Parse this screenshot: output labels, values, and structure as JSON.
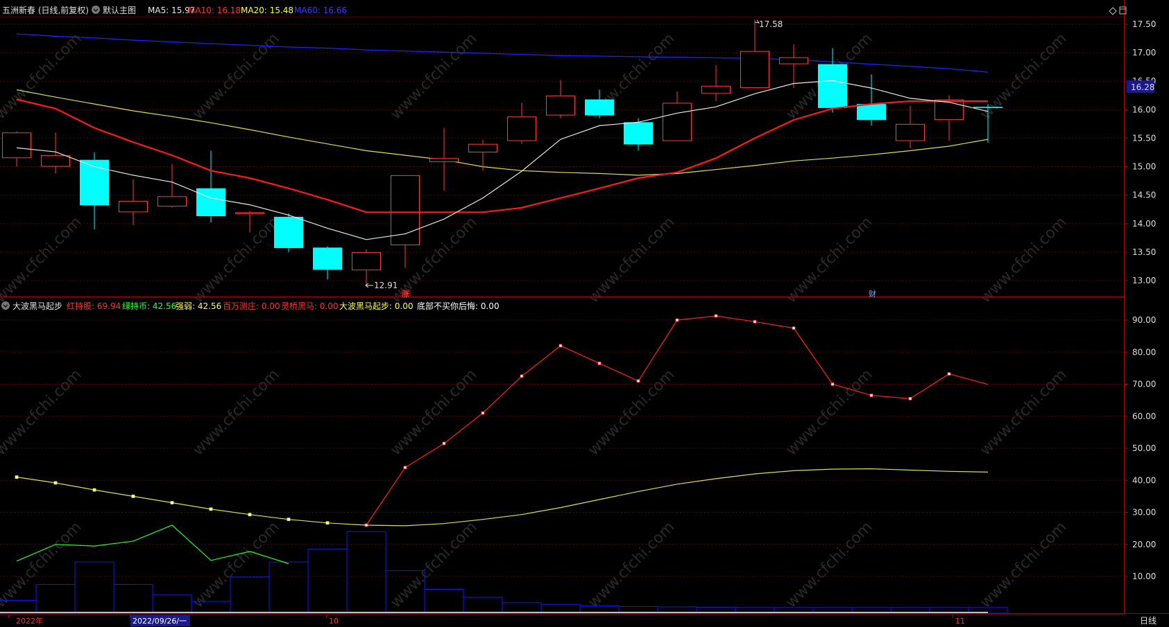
{
  "header": {
    "stock_title": "五洲新春 (日线,前复权)",
    "main_chart_label": "默认主图",
    "ma5": "MA5: 15.97",
    "ma10": "MA10: 16.18",
    "ma20": "MA20: 15.48",
    "ma60": "MA60: 16.66"
  },
  "sub_header": {
    "indicator_name": "大波黑马起步",
    "items": [
      {
        "text": "红持股: 69.94",
        "color": "#ff3030"
      },
      {
        "text": "绿持币: 42.56",
        "color": "#30ff30"
      },
      {
        "text": "强弱: 42.56",
        "color": "#ffff40"
      },
      {
        "text": "百万测庄: 0.00",
        "color": "#ff3030"
      },
      {
        "text": "灵桥黑马: 0.00",
        "color": "#ff3030"
      },
      {
        "text": "大波黑马起步: 0.00",
        "color": "#ffff40"
      },
      {
        "text": "底部不买你后悔: 0.00",
        "color": "#ffffff"
      }
    ]
  },
  "price_axis": {
    "ticks": [
      "17.50",
      "17.00",
      "16.50",
      "16.00",
      "15.50",
      "15.00",
      "14.50",
      "14.00",
      "13.50",
      "13.00"
    ],
    "current_price": "16.28"
  },
  "indicator_axis": {
    "ticks": [
      "90.00",
      "80.00",
      "70.00",
      "60.00",
      "50.00",
      "40.00",
      "30.00",
      "20.00",
      "10.00"
    ]
  },
  "annotations": {
    "high_label": "17.58",
    "low_label": "12.91",
    "zhang_marker": "涨",
    "cai_marker": "财"
  },
  "time_axis": {
    "year_label": "2022年",
    "cursor_date": "2022/09/26/一",
    "month_oct": "10",
    "month_nov": "11",
    "period_button": "日线"
  },
  "watermark": "www.cfchi.com",
  "colors": {
    "up": "#ff3a3a",
    "down": "#00ffff",
    "ma5": "#e8e8e8",
    "ma10": "#ff1a1a",
    "ma20": "#e0e040",
    "ma60": "#2020ff",
    "grid": "#5a0000",
    "frame": "#aa0000"
  },
  "chart_data": [
    {
      "type": "candlestick",
      "title": "五洲新春 (日线,前复权)",
      "ylim": [
        12.8,
        17.75
      ],
      "candles": [
        {
          "o": 15.15,
          "h": 15.62,
          "l": 15.0,
          "c": 15.6
        },
        {
          "o": 15.0,
          "h": 15.6,
          "l": 14.88,
          "c": 15.2
        },
        {
          "o": 15.12,
          "h": 15.25,
          "l": 13.9,
          "c": 14.32
        },
        {
          "o": 14.2,
          "h": 14.78,
          "l": 13.97,
          "c": 14.4
        },
        {
          "o": 14.3,
          "h": 15.05,
          "l": 14.28,
          "c": 14.48
        },
        {
          "o": 14.62,
          "h": 15.28,
          "l": 14.02,
          "c": 14.13
        },
        {
          "o": 14.17,
          "h": 14.22,
          "l": 13.85,
          "c": 14.2
        },
        {
          "o": 14.12,
          "h": 14.18,
          "l": 13.5,
          "c": 13.57
        },
        {
          "o": 13.58,
          "h": 13.6,
          "l": 13.02,
          "c": 13.19
        },
        {
          "o": 13.18,
          "h": 13.55,
          "l": 12.91,
          "c": 13.5
        },
        {
          "o": 13.62,
          "h": 14.85,
          "l": 13.22,
          "c": 14.85
        },
        {
          "o": 15.08,
          "h": 15.68,
          "l": 14.58,
          "c": 15.15
        },
        {
          "o": 15.25,
          "h": 15.47,
          "l": 14.93,
          "c": 15.4
        },
        {
          "o": 15.45,
          "h": 16.12,
          "l": 15.4,
          "c": 15.88
        },
        {
          "o": 15.9,
          "h": 16.52,
          "l": 15.85,
          "c": 16.25
        },
        {
          "o": 16.18,
          "h": 16.35,
          "l": 15.85,
          "c": 15.9
        },
        {
          "o": 15.78,
          "h": 15.85,
          "l": 15.28,
          "c": 15.39
        },
        {
          "o": 15.45,
          "h": 16.32,
          "l": 15.45,
          "c": 16.12
        },
        {
          "o": 16.28,
          "h": 16.78,
          "l": 16.15,
          "c": 16.42
        },
        {
          "o": 16.38,
          "h": 17.58,
          "l": 16.38,
          "c": 17.03
        },
        {
          "o": 16.8,
          "h": 17.15,
          "l": 16.38,
          "c": 16.92
        },
        {
          "o": 16.8,
          "h": 17.08,
          "l": 15.95,
          "c": 16.03
        },
        {
          "o": 16.1,
          "h": 16.62,
          "l": 15.72,
          "c": 15.82
        },
        {
          "o": 15.45,
          "h": 16.07,
          "l": 15.32,
          "c": 15.75
        },
        {
          "o": 15.82,
          "h": 16.25,
          "l": 15.45,
          "c": 16.18
        },
        {
          "o": 16.05,
          "h": 16.1,
          "l": 15.42,
          "c": 16.03
        }
      ],
      "ma5": [
        15.33,
        15.26,
        15.0,
        14.85,
        14.73,
        14.45,
        14.33,
        14.15,
        13.92,
        13.72,
        13.82,
        14.08,
        14.45,
        14.92,
        15.48,
        15.72,
        15.78,
        15.94,
        16.05,
        16.28,
        16.46,
        16.51,
        16.38,
        16.2,
        16.13,
        15.97
      ],
      "ma10": [
        16.18,
        16.02,
        15.68,
        15.43,
        15.2,
        14.93,
        14.8,
        14.62,
        14.42,
        14.2,
        14.2,
        14.2,
        14.2,
        14.28,
        14.45,
        14.62,
        14.8,
        14.9,
        15.15,
        15.5,
        15.82,
        16.02,
        16.1,
        16.15,
        16.15,
        16.15
      ],
      "ma20": [
        16.35,
        16.22,
        16.1,
        15.98,
        15.88,
        15.77,
        15.65,
        15.52,
        15.4,
        15.28,
        15.2,
        15.12,
        15.0,
        14.93,
        14.9,
        14.88,
        14.85,
        14.88,
        14.95,
        15.02,
        15.1,
        15.15,
        15.21,
        15.28,
        15.36,
        15.48
      ],
      "ma60": [
        17.33,
        17.29,
        17.26,
        17.22,
        17.19,
        17.16,
        17.13,
        17.1,
        17.08,
        17.05,
        17.03,
        17.01,
        16.99,
        16.97,
        16.95,
        16.94,
        16.93,
        16.92,
        16.91,
        16.9,
        16.88,
        16.84,
        16.8,
        16.76,
        16.72,
        16.66
      ]
    },
    {
      "type": "line",
      "title": "大波黑马起步",
      "ylim": [
        0,
        95
      ],
      "series": [
        {
          "name": "红持股",
          "values": [
            null,
            null,
            null,
            null,
            null,
            null,
            null,
            null,
            null,
            26.0,
            44.0,
            51.5,
            61.0,
            72.5,
            82.0,
            76.5,
            71.0,
            90.0,
            91.3,
            89.5,
            87.5,
            70.0,
            66.5,
            65.5,
            73.2,
            69.94
          ]
        },
        {
          "name": "强弱",
          "values": [
            41.0,
            39.2,
            37.0,
            35.0,
            33.0,
            31.0,
            29.3,
            27.8,
            26.7,
            26.0,
            25.8,
            26.5,
            27.8,
            29.3,
            31.5,
            34.0,
            36.5,
            38.8,
            40.5,
            42.0,
            43.0,
            43.5,
            43.6,
            43.2,
            42.8,
            42.56
          ]
        },
        {
          "name": "绿持币",
          "values": [
            14.8,
            20.0,
            19.5,
            21.0,
            26.0,
            15.0,
            17.8,
            14.0,
            null,
            null,
            24.0,
            null,
            null,
            null,
            null,
            null,
            null,
            null,
            null,
            null,
            null,
            null,
            null,
            null,
            null,
            null
          ]
        }
      ],
      "bars": [
        2.5,
        7.5,
        14.5,
        7.5,
        4.2,
        2.2,
        9.8,
        14.5,
        18.5,
        24.0,
        11.8,
        6.0,
        3.5,
        1.8,
        1.3,
        0.8,
        0.6,
        0.5,
        0.4,
        0.3,
        0.3,
        0.3,
        0.3,
        0.3,
        0.3,
        0.3
      ]
    }
  ]
}
